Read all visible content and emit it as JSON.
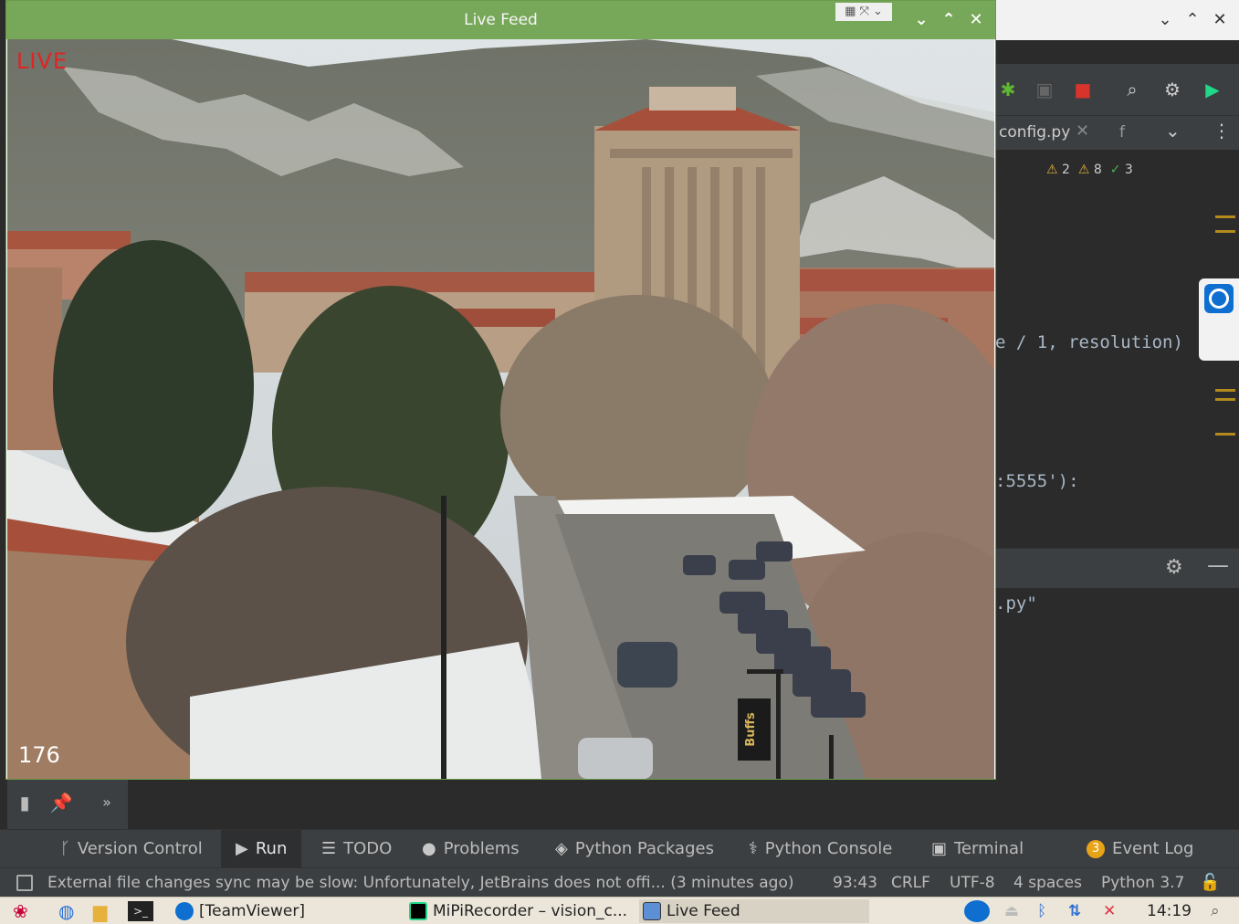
{
  "live_feed": {
    "title": "Live Feed",
    "live_label": "LIVE",
    "frame_counter": "176",
    "video_sign_text": "Buffs"
  },
  "ide": {
    "editor_tab": "config.py",
    "editor_tab_second": "f",
    "inspections": {
      "warnings_a": "2",
      "warnings_b": "8",
      "ok": "3"
    },
    "code_line_1": "e / 1, resolution)",
    "code_line_2": ":5555'):",
    "run_line": ".py\""
  },
  "tool_tabs": [
    {
      "label": "Version Control",
      "icon": "branch-icon"
    },
    {
      "label": "Run",
      "icon": "play-icon"
    },
    {
      "label": "TODO",
      "icon": "list-icon"
    },
    {
      "label": "Problems",
      "icon": "info-icon"
    },
    {
      "label": "Python Packages",
      "icon": "layers-icon"
    },
    {
      "label": "Python Console",
      "icon": "python-icon"
    },
    {
      "label": "Terminal",
      "icon": "terminal-icon"
    },
    {
      "label": "Event Log",
      "icon": "event-badge",
      "badge": "3"
    }
  ],
  "status_bar": {
    "message": "External file changes sync may be slow: Unfortunately, JetBrains does not offi... (3 minutes ago)",
    "position": "93:43",
    "line_sep": "CRLF",
    "encoding": "UTF-8",
    "indent": "4 spaces",
    "interpreter": "Python 3.7"
  },
  "taskbar": {
    "tasks": [
      {
        "label": "[TeamViewer]",
        "icon": "teamviewer-icon"
      },
      {
        "label": "MiPiRecorder – vision_c...",
        "icon": "pycharm-icon"
      },
      {
        "label": "Live Feed",
        "icon": "window-icon"
      }
    ],
    "clock": "14:19"
  },
  "colors": {
    "live_feed_titlebar": "#77a859",
    "live_label": "#e02424",
    "ide_bg": "#2b2b2b",
    "ide_panel": "#3c3f41",
    "taskbar_bg": "#ebe6d9"
  }
}
